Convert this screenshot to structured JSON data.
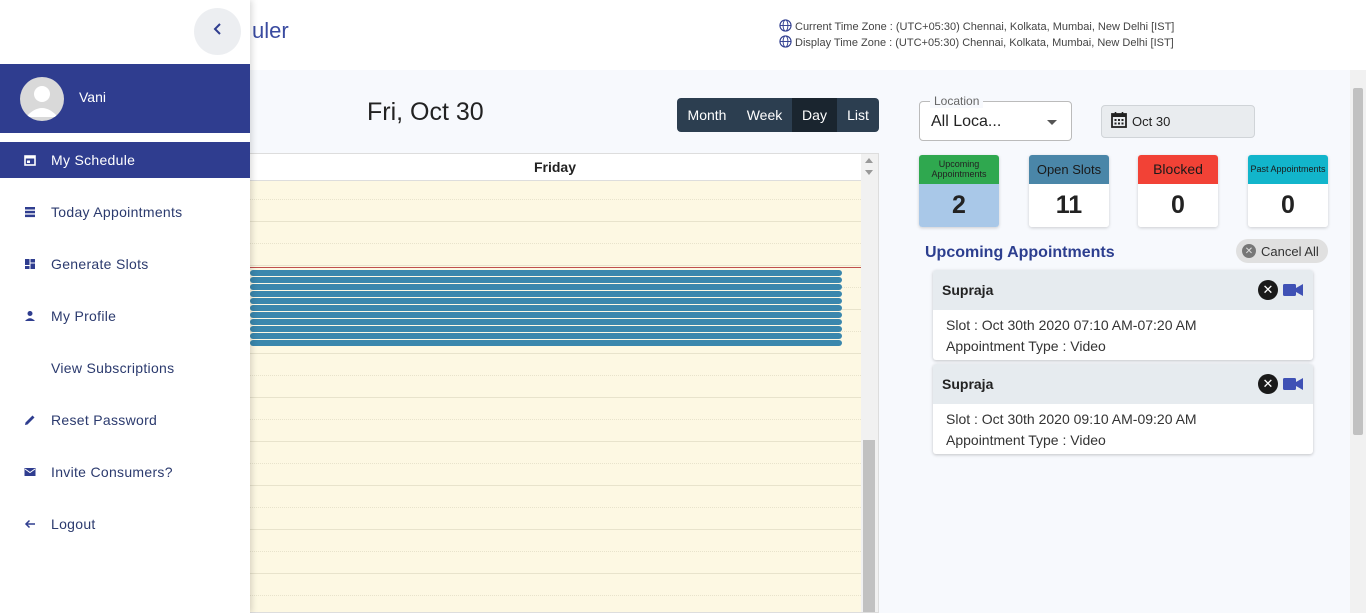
{
  "header": {
    "app_title": "uler",
    "current_tz": "Current Time Zone : (UTC+05:30) Chennai, Kolkata, Mumbai, New Delhi [IST]",
    "display_tz": "Display Time Zone : (UTC+05:30) Chennai, Kolkata, Mumbai, New Delhi [IST]"
  },
  "sidebar": {
    "user_name": "Vani",
    "items": [
      {
        "label": "My Schedule",
        "icon": "calendar-icon",
        "active": true
      },
      {
        "label": "Today Appointments",
        "icon": "list-icon",
        "active": false
      },
      {
        "label": "Generate Slots",
        "icon": "dashboard-icon",
        "active": false
      },
      {
        "label": "My Profile",
        "icon": "person-icon",
        "active": false
      },
      {
        "label": "View Subscriptions",
        "icon": "",
        "active": false
      },
      {
        "label": "Reset Password",
        "icon": "pencil-icon",
        "active": false
      },
      {
        "label": "Invite Consumers?",
        "icon": "mail-icon",
        "active": false
      },
      {
        "label": "Logout",
        "icon": "arrow-left-icon",
        "active": false
      }
    ]
  },
  "calendar": {
    "date_title": "Fri, Oct 30",
    "views": [
      "Month",
      "Week",
      "Day",
      "List"
    ],
    "active_view": "Day",
    "day_header": "Friday",
    "event_count": 11
  },
  "filters": {
    "location_label": "Location",
    "location_value": "All Loca...",
    "date_value": "Oct 30"
  },
  "stats": [
    {
      "label": "Upcoming Appointments",
      "value": "2",
      "head_color": "#2fa84f",
      "body_color": "#a9c8e8",
      "head_text": "#222"
    },
    {
      "label": "Open Slots",
      "value": "11",
      "head_color": "#4a86a8",
      "body_color": "#ffffff",
      "head_text": "#1a1a1a"
    },
    {
      "label": "Blocked",
      "value": "0",
      "head_color": "#f24236",
      "body_color": "#ffffff",
      "head_text": "#1a1a1a"
    },
    {
      "label": "Past Appointments",
      "value": "0",
      "head_color": "#12b5cb",
      "body_color": "#ffffff",
      "head_text": "#1a1a1a"
    }
  ],
  "upcoming": {
    "title": "Upcoming Appointments",
    "cancel_all": "Cancel All",
    "appointments": [
      {
        "name": "Supraja",
        "slot": "Slot : Oct 30th 2020 07:10 AM-07:20 AM",
        "type": "Appointment Type : Video"
      },
      {
        "name": "Supraja",
        "slot": "Slot : Oct 30th 2020 09:10 AM-09:20 AM",
        "type": "Appointment Type : Video"
      }
    ]
  },
  "colors": {
    "brand": "#2f3d8f",
    "event": "#3a87ad",
    "calendar_bg": "#fdf8e3",
    "video_icon": "#3f51b5"
  }
}
